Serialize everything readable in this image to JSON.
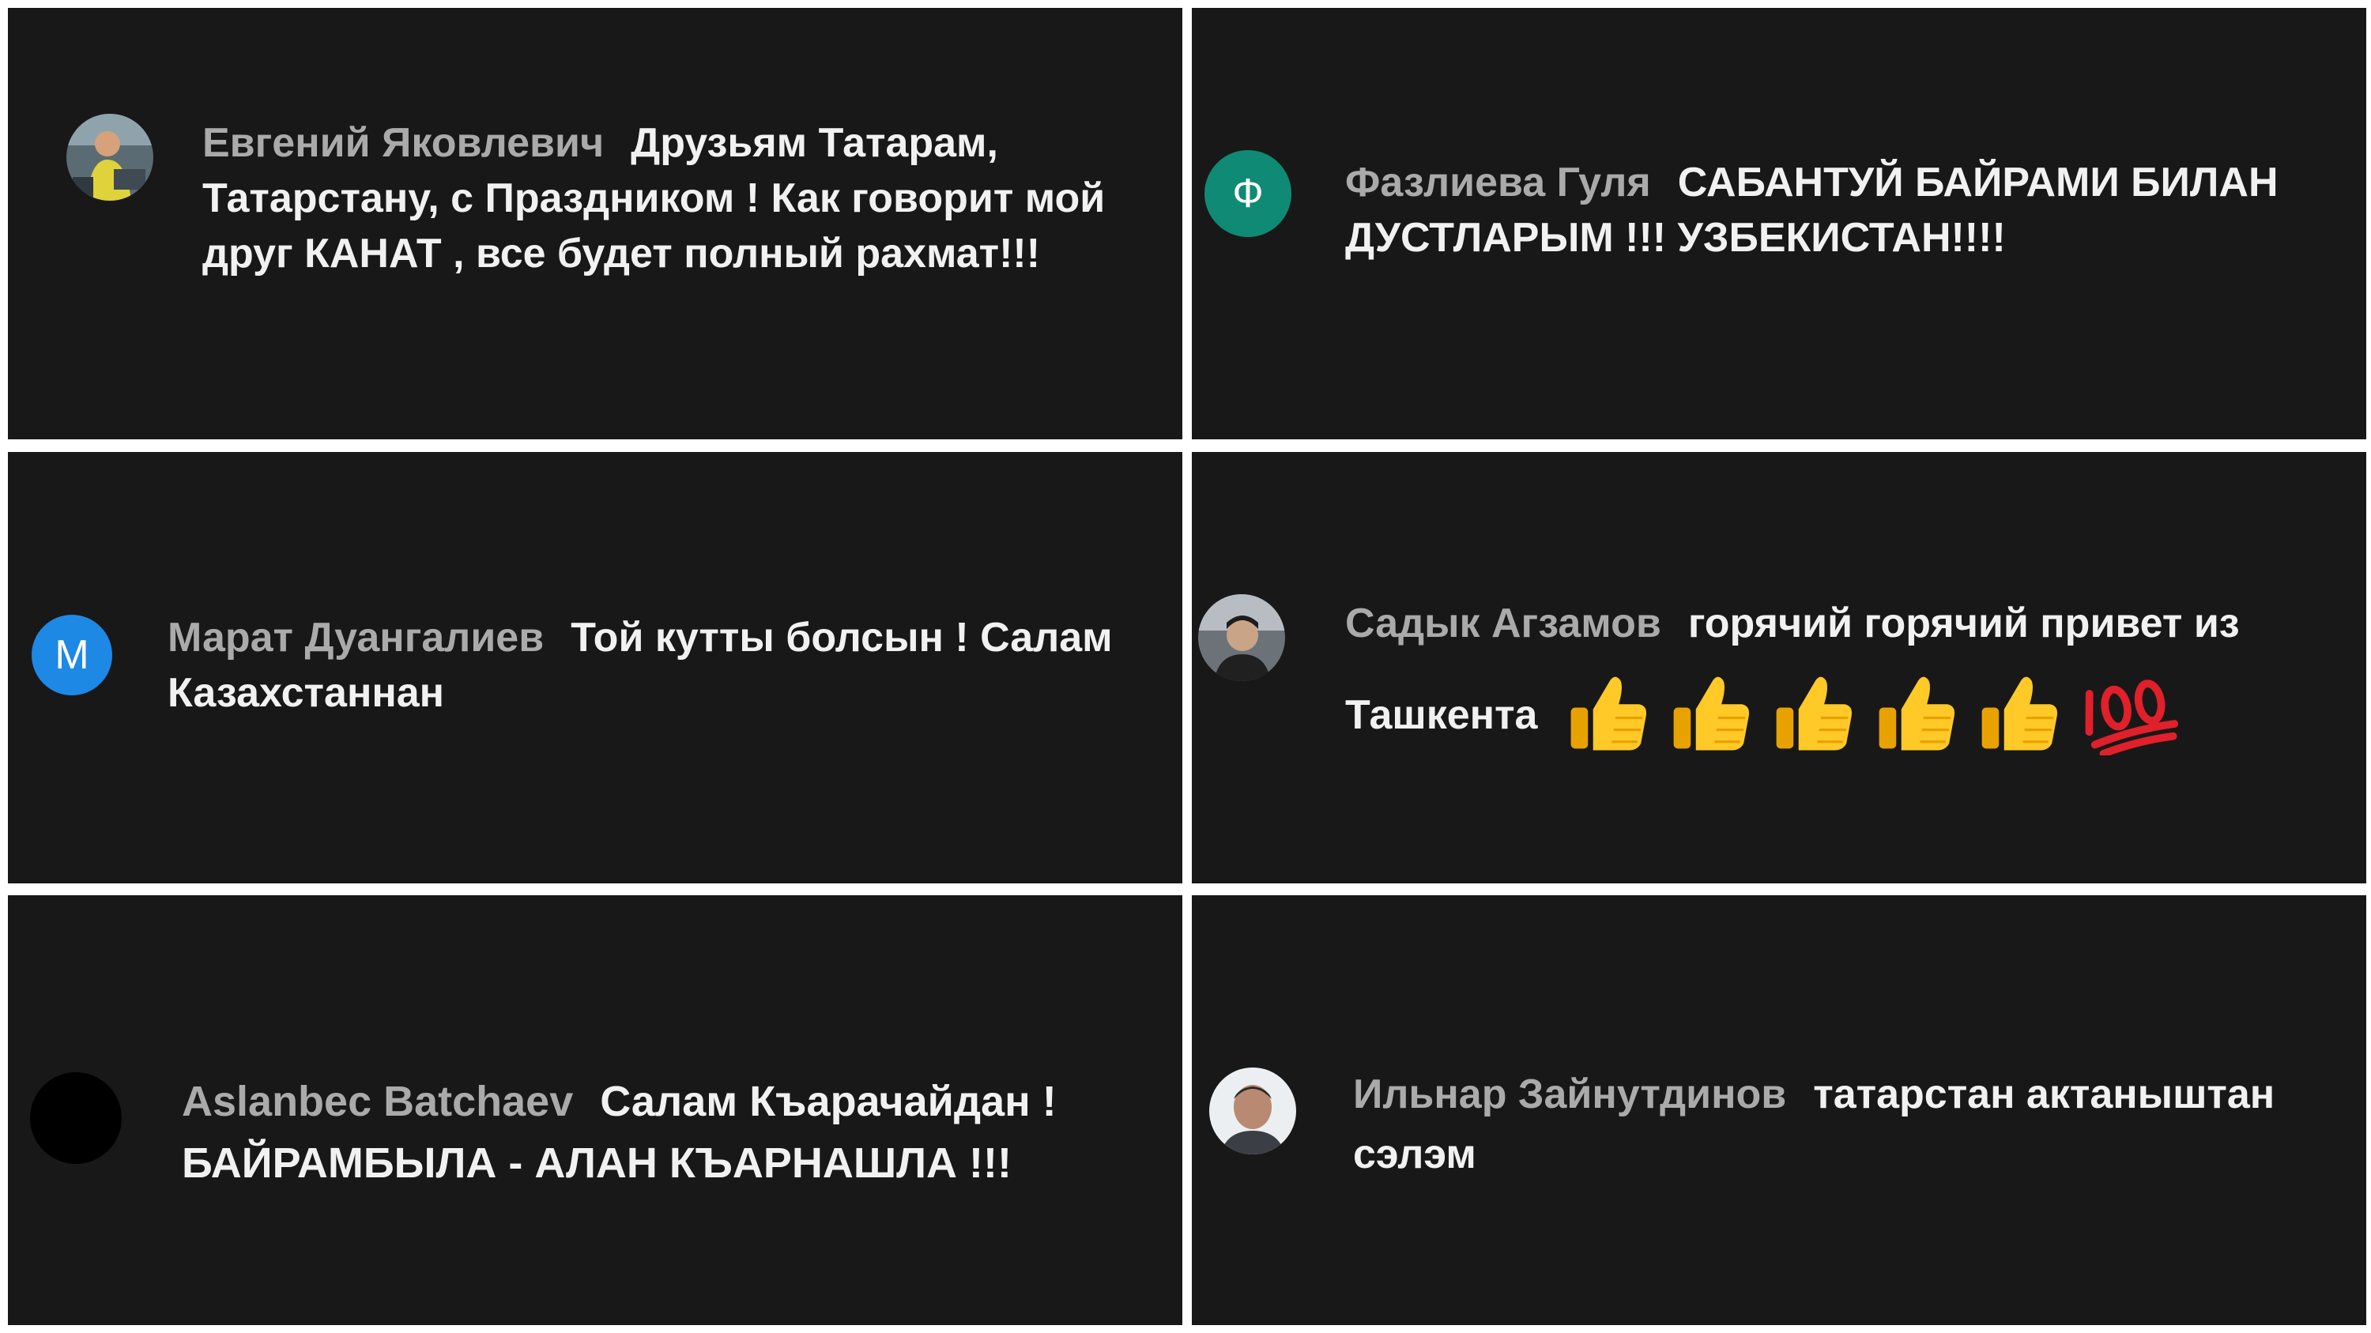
{
  "colors": {
    "panel_bg": "#181818",
    "author_text": "#aaaaaa",
    "comment_text": "#f1f1f1",
    "avatar_teal": "#0f8a74",
    "avatar_blue": "#1e88e5",
    "avatar_black": "#000000"
  },
  "comments": [
    {
      "author": "Евгений Яковлевич",
      "avatar_type": "photo",
      "text": "Друзьям Татарам, Татарстану, с Праздником ! Как говорит мой друг КАНАТ , все будет полный рахмат!!!"
    },
    {
      "author": "Фазлиева Гуля",
      "avatar_type": "letter",
      "avatar_letter": "Ф",
      "text": "САБАНТУЙ БАЙРАМИ БИЛАН ДУСТЛАРЫМ !!! УЗБЕКИСТАН!!!!"
    },
    {
      "author": "Марат Дуангалиев",
      "avatar_type": "letter",
      "avatar_letter": "М",
      "text": "Той кутты болсын ! Салам Казахстаннан"
    },
    {
      "author": "Садык Агзамов",
      "avatar_type": "photo",
      "text_line1": "горячий горячий привет из",
      "text_line2": "Ташкента",
      "emojis": [
        "thumbs-up",
        "thumbs-up",
        "thumbs-up",
        "thumbs-up",
        "thumbs-up",
        "hundred-points"
      ]
    },
    {
      "author": "Aslanbec Batchaev",
      "avatar_type": "blank",
      "text": "Салам Къарачайдан ! БАЙРАМБЫЛА - АЛАН КЪАРНАШЛА !!!"
    },
    {
      "author": "Ильнар Зайнутдинов",
      "avatar_type": "photo",
      "text": "татарстан актаныштан сэлэм"
    }
  ]
}
